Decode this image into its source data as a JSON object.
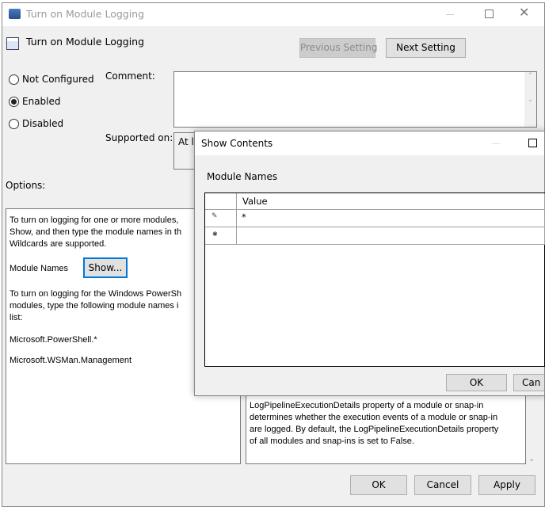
{
  "window": {
    "title": "Turn on Module Logging",
    "policy_title": "Turn on Module Logging",
    "prev_label": "Previous Setting",
    "next_label": "Next Setting"
  },
  "state": {
    "options": [
      "Not Configured",
      "Enabled",
      "Disabled"
    ],
    "selected": "Enabled"
  },
  "comment": {
    "label": "Comment:",
    "value": ""
  },
  "supported": {
    "label": "Supported on:",
    "value": "At le"
  },
  "options": {
    "label": "Options:",
    "lines1": [
      "To turn on logging for one or more modules,",
      "Show, and then type the module names in th",
      "Wildcards are supported."
    ],
    "module_names_label": "Module Names",
    "show_label": "Show...",
    "lines2": [
      "To turn on logging for the Windows PowerSh",
      "modules, type the following module names i",
      "list:"
    ],
    "module1": "Microsoft.PowerShell.*",
    "module2": "Microsoft.WSMan.Management"
  },
  "help": {
    "lines": [
      "LogPipelineExecutionDetails property of a module or snap-in",
      "determines whether the execution events of a module or snap-in",
      "are logged. By default, the LogPipelineExecutionDetails property",
      "of all modules and snap-ins is set to False."
    ]
  },
  "footer": {
    "ok": "OK",
    "cancel": "Cancel",
    "apply": "Apply"
  },
  "dialog": {
    "title": "Show Contents",
    "label": "Module Names",
    "column": "Value",
    "rows": [
      "*",
      ""
    ],
    "ok": "OK",
    "cancel": "Can"
  }
}
